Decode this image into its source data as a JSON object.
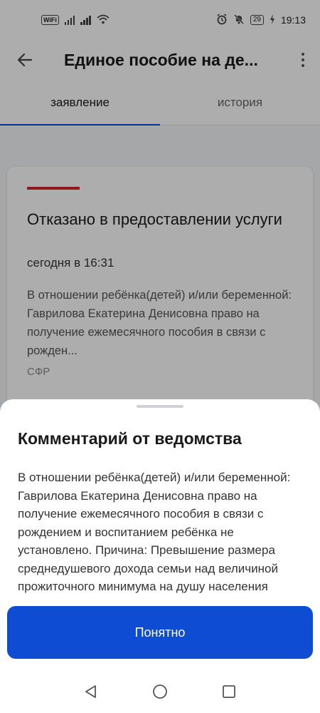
{
  "status_bar": {
    "wifi_label": "WiFi",
    "battery": "29",
    "time": "19:13",
    "icons": [
      "signal-icon",
      "signal-icon",
      "wifi-icon",
      "alarm-icon",
      "mute-icon",
      "battery-icon",
      "charging-icon"
    ]
  },
  "app_bar": {
    "title": "Единое пособие на де...",
    "back_icon": "arrow-left-icon",
    "menu_icon": "more-vertical-icon"
  },
  "tabs": [
    {
      "label": "заявление",
      "active": true
    },
    {
      "label": "история",
      "active": false
    }
  ],
  "card": {
    "status_color": "#d4242a",
    "title": "Отказано в предоставлении услуги",
    "date": "сегодня в 16:31",
    "description": "В отношении ребёнка(детей) и/или беременной: Гаврилова Екатерина Денисовна право на получение ежемесячного пособия в связи с рожден...",
    "source": "СФР"
  },
  "sheet": {
    "title": "Комментарий от ведомства",
    "body": "В отношении ребёнка(детей) и/или беременной: Гаврилова Екатерина Денисовна право на получение ежемесячного пособия в связи с рождением и воспитанием ребёнка не установлено. Причина: Превышение размера среднедушевого дохода семьи над величиной прожиточного минимума на душу населения",
    "button_label": "Понятно"
  },
  "colors": {
    "accent": "#0d4cd3",
    "error": "#d4242a"
  },
  "nav_bar": {
    "icons": [
      "back-triangle-icon",
      "home-circle-icon",
      "recents-square-icon"
    ]
  }
}
